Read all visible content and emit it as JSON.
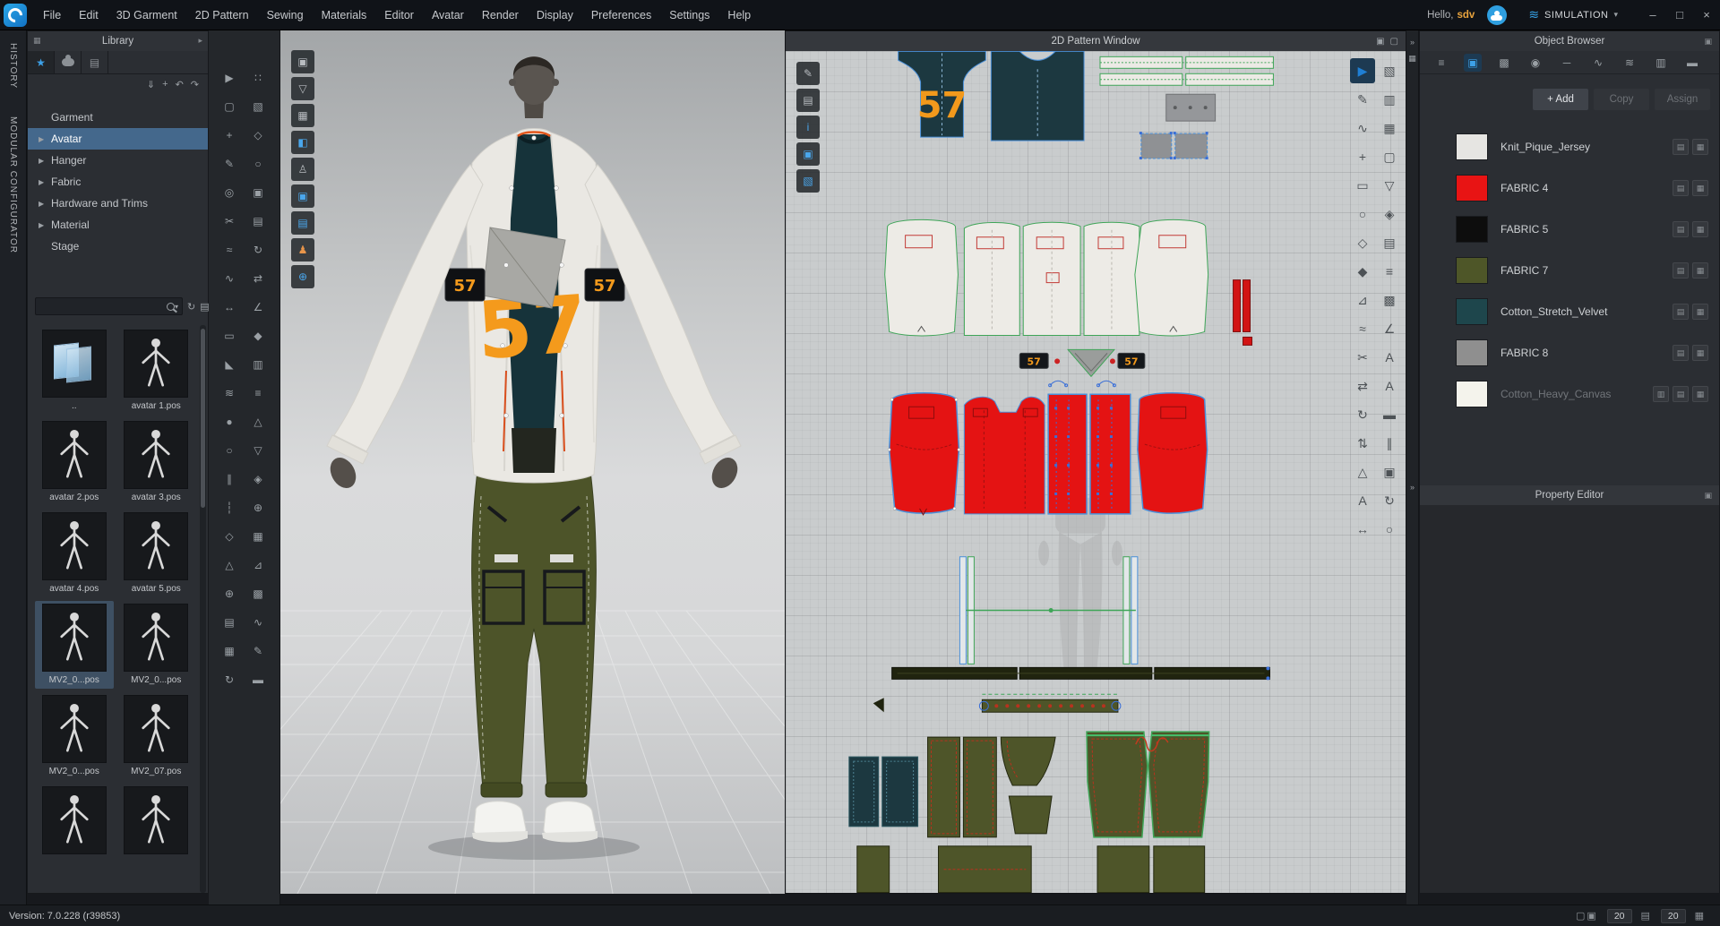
{
  "garment": {
    "number": "57"
  },
  "titlebar": {
    "menu_items": [
      "File",
      "Edit",
      "3D Garment",
      "2D Pattern",
      "Sewing",
      "Materials",
      "Editor",
      "Avatar",
      "Render",
      "Display",
      "Preferences",
      "Settings",
      "Help"
    ],
    "greeting_prefix": "Hello,",
    "username": "sdv",
    "simulation_label": "SIMULATION"
  },
  "side_tabs": [
    {
      "label": "HISTORY"
    },
    {
      "label": "MODULAR CONFIGURATOR"
    }
  ],
  "library": {
    "title": "Library",
    "search_value": "",
    "tree": [
      {
        "label": "Garment"
      },
      {
        "label": "Avatar",
        "arrow": true,
        "selected": true
      },
      {
        "label": "Hanger",
        "arrow": true
      },
      {
        "label": "Fabric",
        "arrow": true
      },
      {
        "label": "Hardware and Trims",
        "arrow": true
      },
      {
        "label": "Material",
        "arrow": true
      },
      {
        "label": "Stage"
      }
    ],
    "thumbnails": [
      {
        "label": "..",
        "folder": true
      },
      {
        "label": "avatar 1.pos"
      },
      {
        "label": "avatar 2.pos"
      },
      {
        "label": "avatar 3.pos"
      },
      {
        "label": "avatar 4.pos"
      },
      {
        "label": "avatar 5.pos"
      },
      {
        "label": "MV2_0...pos",
        "selected": true
      },
      {
        "label": "MV2_0...pos"
      },
      {
        "label": "MV2_0...pos"
      },
      {
        "label": "MV2_07.pos"
      },
      {
        "label": ""
      },
      {
        "label": ""
      }
    ]
  },
  "toolbar3d_col1": [
    {
      "name": "select-move-icon",
      "glyph": "▶"
    },
    {
      "name": "select-box-icon",
      "glyph": "▢"
    },
    {
      "name": "transform-icon",
      "glyph": "+"
    },
    {
      "name": "pen-3d-icon",
      "glyph": "✎"
    },
    {
      "name": "pin-icon",
      "glyph": "◎"
    },
    {
      "name": "scissors-icon",
      "glyph": "✂"
    },
    {
      "name": "segment-sewing-icon",
      "glyph": "≈"
    },
    {
      "name": "free-sewing-icon",
      "glyph": "∿"
    },
    {
      "name": "measure-icon",
      "glyph": "↔"
    },
    {
      "name": "tape-icon",
      "glyph": "▭"
    },
    {
      "name": "fold-icon",
      "glyph": "◣"
    },
    {
      "name": "steam-icon",
      "glyph": "≋"
    },
    {
      "name": "button-icon",
      "glyph": "●"
    },
    {
      "name": "buttonhole-icon",
      "glyph": "○"
    },
    {
      "name": "zipper-icon",
      "glyph": "∥"
    },
    {
      "name": "topstitch-icon",
      "glyph": "┆"
    },
    {
      "name": "dart-icon",
      "glyph": "◇"
    },
    {
      "name": "grading-icon",
      "glyph": "△"
    },
    {
      "name": "attach-icon",
      "glyph": "⊕"
    },
    {
      "name": "texture-icon",
      "glyph": "▤"
    },
    {
      "name": "uv-icon",
      "glyph": "▦"
    },
    {
      "name": "refresh-icon",
      "glyph": "↻"
    }
  ],
  "toolbar3d_col2": [
    {
      "name": "drag-handle-icon",
      "glyph": "∷"
    },
    {
      "name": "show-seamline-icon",
      "glyph": "▧"
    },
    {
      "name": "show-points-icon",
      "glyph": "◇"
    },
    {
      "name": "show-circle-icon",
      "glyph": "○"
    },
    {
      "name": "solid-view-icon",
      "glyph": "▣"
    },
    {
      "name": "panel-view-icon",
      "glyph": "▤"
    },
    {
      "name": "rotate-view-icon",
      "glyph": "↻"
    },
    {
      "name": "swap-view-icon",
      "glyph": "⇄"
    },
    {
      "name": "angle-snap-icon",
      "glyph": "∠"
    },
    {
      "name": "gem-icon",
      "glyph": "◆"
    },
    {
      "name": "rows-icon",
      "glyph": "▥"
    },
    {
      "name": "lines-icon",
      "glyph": "≡"
    },
    {
      "name": "up-icon",
      "glyph": "△"
    },
    {
      "name": "down-icon",
      "glyph": "▽"
    },
    {
      "name": "mirror-icon",
      "glyph": "◈"
    },
    {
      "name": "add-circle-icon",
      "glyph": "⊕"
    },
    {
      "name": "grid-icon",
      "glyph": "▦"
    },
    {
      "name": "wedge-icon",
      "glyph": "⊿"
    },
    {
      "name": "hatch-icon",
      "glyph": "▩"
    },
    {
      "name": "wave-icon",
      "glyph": "∿"
    },
    {
      "name": "draw-icon",
      "glyph": "✎"
    },
    {
      "name": "bar-icon",
      "glyph": "▬"
    }
  ],
  "viewport_float_tools": [
    {
      "name": "camera-view-icon",
      "glyph": "▣"
    },
    {
      "name": "show-garment-icon",
      "glyph": "▽"
    },
    {
      "name": "show-fabric-icon",
      "glyph": "▦"
    },
    {
      "name": "paint-icon",
      "glyph": "◧",
      "active": true
    },
    {
      "name": "show-avatar-icon",
      "glyph": "♙"
    },
    {
      "name": "texture-editor-icon",
      "glyph": "▣",
      "active": true
    },
    {
      "name": "layers-icon",
      "glyph": "▤",
      "active": true
    },
    {
      "name": "avatar-skin-icon",
      "glyph": "♟",
      "warm": true
    },
    {
      "name": "world-icon",
      "glyph": "⊕",
      "active": true
    }
  ],
  "pattern_window": {
    "title": "2D Pattern Window",
    "left_tools": [
      {
        "name": "edit-pattern-icon",
        "glyph": "✎"
      },
      {
        "name": "show-panel-icon",
        "glyph": "▤"
      },
      {
        "name": "pattern-info-icon",
        "glyph": "i",
        "active": true
      },
      {
        "name": "texture-edit-icon",
        "glyph": "▣",
        "active": true
      },
      {
        "name": "layer-clone-icon",
        "glyph": "▧",
        "active": true
      }
    ],
    "right_col1": [
      {
        "name": "transform-pattern-icon",
        "glyph": "▶",
        "active": true
      },
      {
        "name": "edit-pattern-2d-icon",
        "glyph": "✎"
      },
      {
        "name": "edit-curve-icon",
        "glyph": "∿"
      },
      {
        "name": "add-point-icon",
        "glyph": "+"
      },
      {
        "name": "rectangle-icon",
        "glyph": "▭"
      },
      {
        "name": "circle-icon",
        "glyph": "○"
      },
      {
        "name": "polygon-icon",
        "glyph": "◇"
      },
      {
        "name": "dart-2d-icon",
        "glyph": "◆"
      },
      {
        "name": "notch-icon",
        "glyph": "⊿"
      },
      {
        "name": "seam-icon",
        "glyph": "≈"
      },
      {
        "name": "cut-sew-icon",
        "glyph": "✂"
      },
      {
        "name": "expand-icon",
        "glyph": "⇄"
      },
      {
        "name": "rotate-icon",
        "glyph": "↻"
      },
      {
        "name": "flip-icon",
        "glyph": "⇅"
      },
      {
        "name": "grade-icon",
        "glyph": "△"
      },
      {
        "name": "annotate-icon",
        "glyph": "A"
      },
      {
        "name": "measure-2d-icon",
        "glyph": "↔"
      }
    ],
    "right_col2": [
      {
        "name": "show-seam-icon",
        "glyph": "▧"
      },
      {
        "name": "show-grain-icon",
        "glyph": "▥"
      },
      {
        "name": "texture-2d-icon",
        "glyph": "▦"
      },
      {
        "name": "pattern-outline-icon",
        "glyph": "▢"
      },
      {
        "name": "shrink-icon",
        "glyph": "▽"
      },
      {
        "name": "symmetry-icon",
        "glyph": "◈"
      },
      {
        "name": "layer-2d-icon",
        "glyph": "▤"
      },
      {
        "name": "baseline-icon",
        "glyph": "≡"
      },
      {
        "name": "grid-snap-icon",
        "glyph": "▩"
      },
      {
        "name": "angle-icon",
        "glyph": "∠"
      },
      {
        "name": "text-tool-icon",
        "glyph": "A"
      },
      {
        "name": "font-tool-icon",
        "glyph": "A"
      },
      {
        "name": "ruler-2d-icon",
        "glyph": "▬"
      },
      {
        "name": "guide-icon",
        "glyph": "∥"
      },
      {
        "name": "print-area-icon",
        "glyph": "▣"
      },
      {
        "name": "sync-icon",
        "glyph": "↻"
      },
      {
        "name": "zoom-icon",
        "glyph": "○"
      }
    ]
  },
  "object_browser": {
    "title": "Object Browser",
    "toolbar": [
      {
        "name": "list-view-icon",
        "glyph": "≡"
      },
      {
        "name": "fabric-tab-icon",
        "glyph": "▣",
        "active": true
      },
      {
        "name": "graphic-tab-icon",
        "glyph": "▩"
      },
      {
        "name": "sphere-tab-icon",
        "glyph": "◉"
      },
      {
        "name": "topstitch-tab-icon",
        "glyph": "─"
      },
      {
        "name": "zigzag-tab-icon",
        "glyph": "∿"
      },
      {
        "name": "shirring-tab-icon",
        "glyph": "≋"
      },
      {
        "name": "piping-tab-icon",
        "glyph": "▥"
      },
      {
        "name": "button-tab-icon",
        "glyph": "▬"
      }
    ],
    "buttons": {
      "add": "+ Add",
      "copy": "Copy",
      "assign": "Assign"
    },
    "fabrics": [
      {
        "name": "Knit_Pique_Jersey",
        "color": "#e6e5e2"
      },
      {
        "name": "FABRIC 4",
        "color": "#e81414"
      },
      {
        "name": "FABRIC 5",
        "color": "#0d0d0d"
      },
      {
        "name": "FABRIC 7",
        "color": "#4e5628"
      },
      {
        "name": "Cotton_Stretch_Velvet",
        "color": "#1e464c"
      },
      {
        "name": "FABRIC 8",
        "color": "#8f8f8f"
      },
      {
        "name": "Cotton_Heavy_Canvas",
        "color": "#f4f3ec",
        "dimmed": true,
        "extra": true
      }
    ]
  },
  "property_editor": {
    "title": "Property Editor"
  },
  "status_bar": {
    "version": "Version: 7.0.228 (r39853)",
    "right": [
      {
        "name": "viewport-toggle-icon",
        "glyph": "▢▣"
      },
      {
        "value": "20"
      },
      {
        "name": "snap-toggle-icon",
        "glyph": "▤"
      },
      {
        "value": "20"
      },
      {
        "name": "grid-toggle-icon",
        "glyph": "▦"
      }
    ]
  }
}
